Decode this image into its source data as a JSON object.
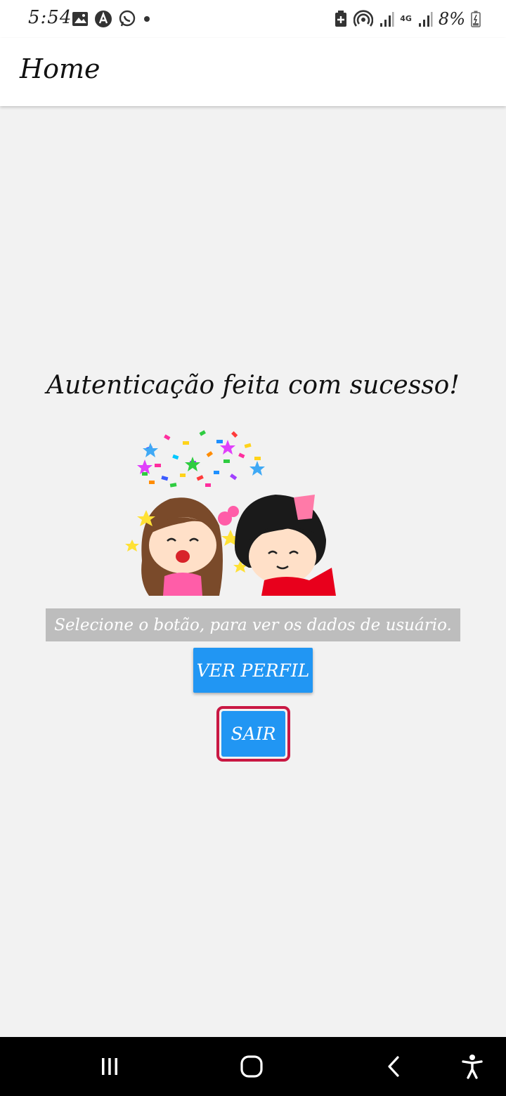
{
  "status_bar": {
    "time": "5:54",
    "battery_percent": "8%",
    "network_label": "4G",
    "icons": [
      "gallery-icon",
      "arrow-app-icon",
      "whatsapp-icon",
      "dot-icon",
      "battery-saver-icon",
      "hotspot-icon",
      "signal-icon",
      "signal-icon",
      "battery-icon"
    ]
  },
  "app_bar": {
    "title": "Home"
  },
  "content": {
    "heading": "Autenticação feita com sucesso!",
    "instruction": "Selecione o botão, para ver os dados de usuário.",
    "profile_button": "VER PERFIL",
    "logout_button": "SAIR"
  },
  "nav_bar": {
    "icons": [
      "recent-apps-icon",
      "home-icon",
      "back-icon",
      "accessibility-icon"
    ]
  },
  "colors": {
    "primary": "#2196f3",
    "highlight": "#c91843",
    "instruction_bg": "#bdbdbd",
    "background": "#f2f2f2"
  }
}
